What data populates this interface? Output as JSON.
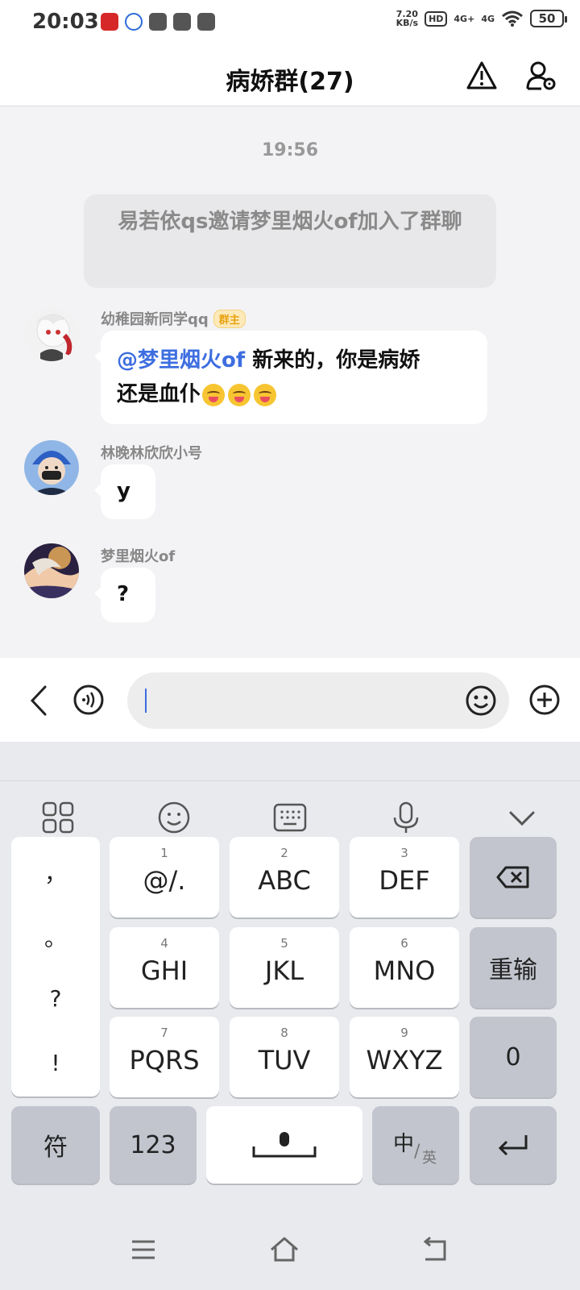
{
  "status": {
    "time": "20:03",
    "net_speed_top": "7.20",
    "net_speed_bottom": "KB/s",
    "hd": "HD",
    "sim1": "4G+",
    "sim2": "4G",
    "battery": "50"
  },
  "header": {
    "title": "病娇群(27)"
  },
  "chat": {
    "time_label": "19:56",
    "system_message": "易若依qs邀请梦里烟火of加入了群聊",
    "messages": [
      {
        "sender": "幼稚园新同学qq",
        "badge": "群主",
        "mention": "@梦里烟火of",
        "text_line1": " 新来的，你是病娇",
        "text_line2": "还是血仆"
      },
      {
        "sender": "林晚林欣欣小号",
        "text": "y"
      },
      {
        "sender": "梦里烟火of",
        "text": "?"
      }
    ]
  },
  "input": {
    "value": ""
  },
  "keyboard": {
    "punct": [
      "，",
      "。",
      "?",
      "!"
    ],
    "keys": [
      {
        "num": "1",
        "label": "@/."
      },
      {
        "num": "2",
        "label": "ABC"
      },
      {
        "num": "3",
        "label": "DEF"
      },
      {
        "num": "4",
        "label": "GHI"
      },
      {
        "num": "5",
        "label": "JKL"
      },
      {
        "num": "6",
        "label": "MNO"
      },
      {
        "num": "7",
        "label": "PQRS"
      },
      {
        "num": "8",
        "label": "TUV"
      },
      {
        "num": "9",
        "label": "WXYZ"
      }
    ],
    "reenter": "重输",
    "zero": "0",
    "symbols": "符",
    "numbers": "123",
    "lang_main": "中",
    "lang_sub": "英"
  },
  "colors": {
    "mention": "#3d6ee0",
    "badge_bg": "#fde9b9",
    "badge_text": "#e9a20f",
    "keyboard_bg": "#e9eaee"
  }
}
